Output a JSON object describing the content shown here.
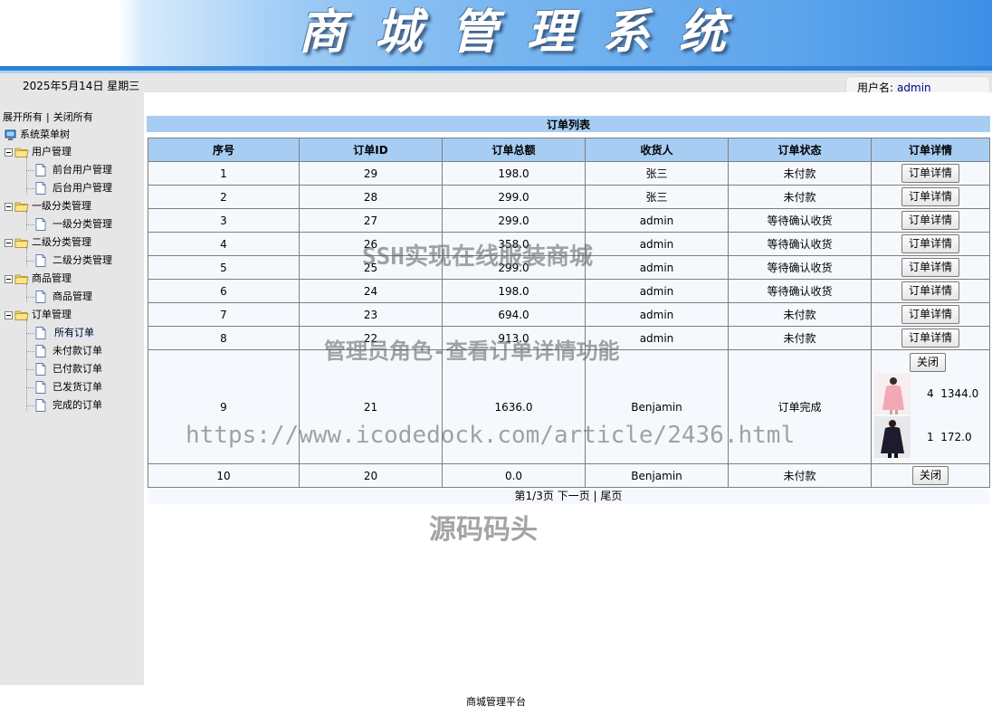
{
  "header": {
    "title": "商城管理系统"
  },
  "statusbar": {
    "date": "2025年5月14日 星期三",
    "user_label": "用户名:",
    "username": "admin"
  },
  "sidebar": {
    "expand_all": "展开所有",
    "separator": "|",
    "collapse_all": "关闭所有",
    "root": "系统菜单树",
    "groups": [
      {
        "label": "用户管理",
        "items": [
          "前台用户管理",
          "后台用户管理"
        ]
      },
      {
        "label": "一级分类管理",
        "items": [
          "一级分类管理"
        ]
      },
      {
        "label": "二级分类管理",
        "items": [
          "二级分类管理"
        ]
      },
      {
        "label": "商品管理",
        "items": [
          "商品管理"
        ]
      },
      {
        "label": "订单管理",
        "items": [
          "所有订单",
          "未付款订单",
          "已付款订单",
          "已发货订单",
          "完成的订单"
        ]
      }
    ],
    "selected": "所有订单"
  },
  "main": {
    "title": "订单列表",
    "columns": [
      "序号",
      "订单ID",
      "订单总额",
      "收货人",
      "订单状态",
      "订单详情"
    ],
    "detail_button": "订单详情",
    "close_button": "关闭",
    "rows": [
      {
        "no": "1",
        "id": "29",
        "total": "198.0",
        "receiver": "张三",
        "status": "未付款"
      },
      {
        "no": "2",
        "id": "28",
        "total": "299.0",
        "receiver": "张三",
        "status": "未付款"
      },
      {
        "no": "3",
        "id": "27",
        "total": "299.0",
        "receiver": "admin",
        "status": "等待确认收货"
      },
      {
        "no": "4",
        "id": "26",
        "total": "358.0",
        "receiver": "admin",
        "status": "等待确认收货"
      },
      {
        "no": "5",
        "id": "25",
        "total": "299.0",
        "receiver": "admin",
        "status": "等待确认收货"
      },
      {
        "no": "6",
        "id": "24",
        "total": "198.0",
        "receiver": "admin",
        "status": "等待确认收货"
      },
      {
        "no": "7",
        "id": "23",
        "total": "694.0",
        "receiver": "admin",
        "status": "未付款"
      },
      {
        "no": "8",
        "id": "22",
        "total": "913.0",
        "receiver": "admin",
        "status": "未付款"
      },
      {
        "no": "9",
        "id": "21",
        "total": "1636.0",
        "receiver": "Benjamin",
        "status": "订单完成",
        "items": [
          {
            "qty": "4",
            "subtotal": "1344.0"
          },
          {
            "qty": "1",
            "subtotal": "172.0"
          }
        ]
      },
      {
        "no": "10",
        "id": "20",
        "total": "0.0",
        "receiver": "Benjamin",
        "status": "未付款"
      }
    ],
    "pager": {
      "page_info": "第1/3页",
      "next": "下一页",
      "separator": "|",
      "last": "尾页"
    }
  },
  "watermarks": {
    "line1": "SSH实现在线服装商城",
    "line2": "管理员角色-查看订单详情功能",
    "line3": "https://www.icodedock.com/article/2436.html",
    "line4": "源码码头"
  },
  "footer": {
    "text": "商城管理平台"
  }
}
